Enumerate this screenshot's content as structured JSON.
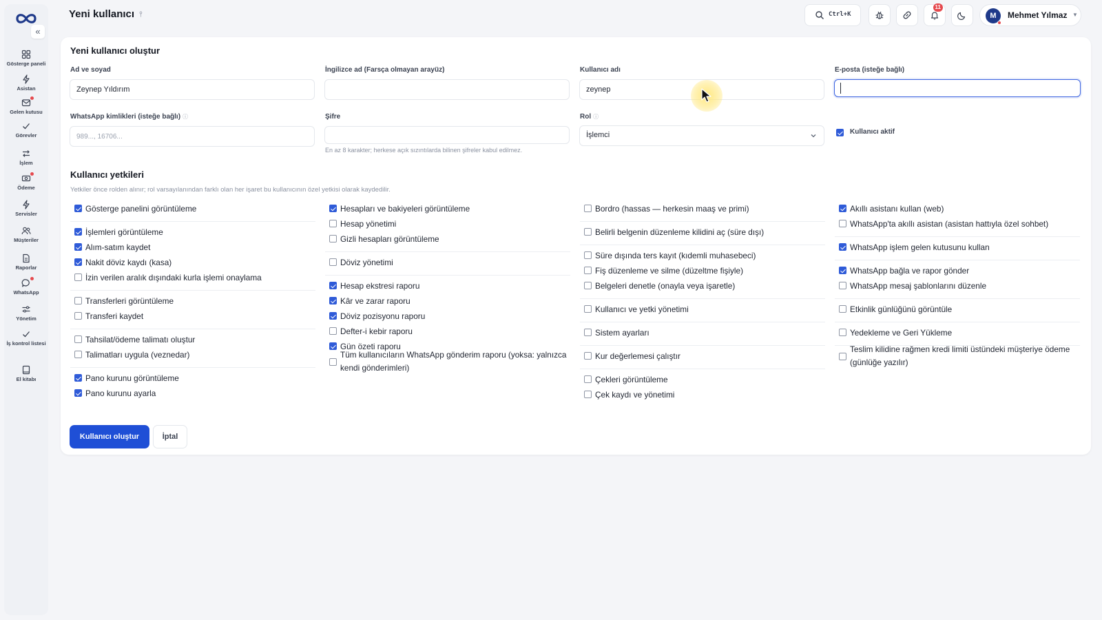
{
  "header": {
    "title": "Yeni kullanıcı",
    "search_shortcut": "Ctrl+K",
    "notifications_count": "11",
    "user_initial": "M",
    "user_name": "Mehmet Yılmaz"
  },
  "sidebar": {
    "items": [
      {
        "label": "Gösterge paneli",
        "icon": "grid-icon",
        "dot": false
      },
      {
        "label": "Asistan",
        "icon": "bolt-icon",
        "dot": false
      },
      {
        "label": "Gelen kutusu",
        "icon": "inbox-icon",
        "dot": true
      },
      {
        "label": "Görevler",
        "icon": "check-icon",
        "dot": false
      },
      {
        "label": "İşlem",
        "icon": "swap-icon",
        "dot": false
      },
      {
        "label": "Ödeme",
        "icon": "cash-icon",
        "dot": true
      },
      {
        "label": "Servisler",
        "icon": "bolt-icon",
        "dot": false
      },
      {
        "label": "Müşteriler",
        "icon": "users-icon",
        "dot": false
      },
      {
        "label": "Raporlar",
        "icon": "file-icon",
        "dot": false
      },
      {
        "label": "WhatsApp",
        "icon": "chat-icon",
        "dot": true
      },
      {
        "label": "Yönetim",
        "icon": "sliders-icon",
        "dot": false
      },
      {
        "label": "İş kontrol listesi",
        "icon": "check-icon",
        "dot": false
      },
      {
        "label": "El kitabı",
        "icon": "book-icon",
        "dot": false
      }
    ]
  },
  "form": {
    "title": "Yeni kullanıcı oluştur",
    "full_name": {
      "label": "Ad ve soyad",
      "value": "Zeynep Yıldırım"
    },
    "english_name": {
      "label": "İngilizce ad (Farsça olmayan arayüz)",
      "value": ""
    },
    "username": {
      "label": "Kullanıcı adı",
      "value": "zeynep"
    },
    "email": {
      "label": "E-posta (isteğe bağlı)",
      "value": ""
    },
    "whatsapp_ids": {
      "label": "WhatsApp kimlikleri (isteğe bağlı)",
      "info": "ⓘ",
      "placeholder": "989..., 16706..."
    },
    "password": {
      "label": "Şifre",
      "value": "",
      "hint": "En az 8 karakter; herkese açık sızıntılarda bilinen şifreler kabul edilmez."
    },
    "role": {
      "label": "Rol",
      "info": "ⓘ",
      "value": "İşlemci"
    },
    "user_active": {
      "label": "Kullanıcı aktif",
      "checked": true
    }
  },
  "permissions": {
    "title": "Kullanıcı yetkileri",
    "subtitle": "Yetkiler önce rolden alınır; rol varsayılanından farklı olan her işaret bu kullanıcının özel yetkisi olarak kaydedilir.",
    "columns": [
      [
        {
          "label": "Gösterge panelini görüntüleme",
          "checked": true
        },
        {
          "label": "İşlemleri görüntüleme",
          "checked": true
        },
        {
          "label": "Alım-satım kaydet",
          "checked": true
        },
        {
          "label": "Nakit döviz kaydı (kasa)",
          "checked": true
        },
        {
          "label": "İzin verilen aralık dışındaki kurla işlemi onaylama",
          "checked": false
        },
        {
          "label": "Transferleri görüntüleme",
          "checked": false
        },
        {
          "label": "Transferi kaydet",
          "checked": false
        },
        {
          "label": "Tahsilat/ödeme talimatı oluştur",
          "checked": false
        },
        {
          "label": "Talimatları uygula (veznedar)",
          "checked": false
        },
        {
          "label": "Pano kurunu görüntüleme",
          "checked": true
        },
        {
          "label": "Pano kurunu ayarla",
          "checked": true
        }
      ],
      [
        {
          "label": "Hesapları ve bakiyeleri görüntüleme",
          "checked": true
        },
        {
          "label": "Hesap yönetimi",
          "checked": false
        },
        {
          "label": "Gizli hesapları görüntüleme",
          "checked": false
        },
        {
          "label": "Döviz yönetimi",
          "checked": false
        },
        {
          "label": "Hesap ekstresi raporu",
          "checked": true
        },
        {
          "label": "Kâr ve zarar raporu",
          "checked": true
        },
        {
          "label": "Döviz pozisyonu raporu",
          "checked": true
        },
        {
          "label": "Defter-i kebir raporu",
          "checked": false
        },
        {
          "label": "Gün özeti raporu",
          "checked": true
        },
        {
          "label": "Tüm kullanıcıların WhatsApp gönderim raporu (yoksa: yalnızca kendi gönderimleri)",
          "checked": false
        }
      ],
      [
        {
          "label": "Bordro (hassas — herkesin maaş ve primi)",
          "checked": false
        },
        {
          "label": "Belirli belgenin düzenleme kilidini aç (süre dışı)",
          "checked": false
        },
        {
          "label": "Süre dışında ters kayıt (kıdemli muhasebeci)",
          "checked": false
        },
        {
          "label": "Fiş düzenleme ve silme (düzeltme fişiyle)",
          "checked": false
        },
        {
          "label": "Belgeleri denetle (onayla veya işaretle)",
          "checked": false
        },
        {
          "label": "Kullanıcı ve yetki yönetimi",
          "checked": false
        },
        {
          "label": "Sistem ayarları",
          "checked": false
        },
        {
          "label": "Kur değerlemesi çalıştır",
          "checked": false
        },
        {
          "label": "Çekleri görüntüleme",
          "checked": false
        },
        {
          "label": "Çek kaydı ve yönetimi",
          "checked": false
        }
      ],
      [
        {
          "label": "Akıllı asistanı kullan (web)",
          "checked": true
        },
        {
          "label": "WhatsApp'ta akıllı asistan (asistan hattıyla özel sohbet)",
          "checked": false
        },
        {
          "label": "WhatsApp işlem gelen kutusunu kullan",
          "checked": true
        },
        {
          "label": "WhatsApp bağla ve rapor gönder",
          "checked": true
        },
        {
          "label": "WhatsApp mesaj şablonlarını düzenle",
          "checked": false
        },
        {
          "label": "Etkinlik günlüğünü görüntüle",
          "checked": false
        },
        {
          "label": "Yedekleme ve Geri Yükleme",
          "checked": false
        },
        {
          "label": "Teslim kilidine rağmen kredi limiti üstündeki müşteriye ödeme (günlüğe yazılır)",
          "checked": false
        }
      ]
    ]
  },
  "actions": {
    "create_label": "Kullanıcı oluştur",
    "cancel_label": "İptal"
  },
  "colors": {
    "primary": "#1f4fd6",
    "checkbox_on": "#2f5bd8",
    "badge": "#e5484d"
  }
}
